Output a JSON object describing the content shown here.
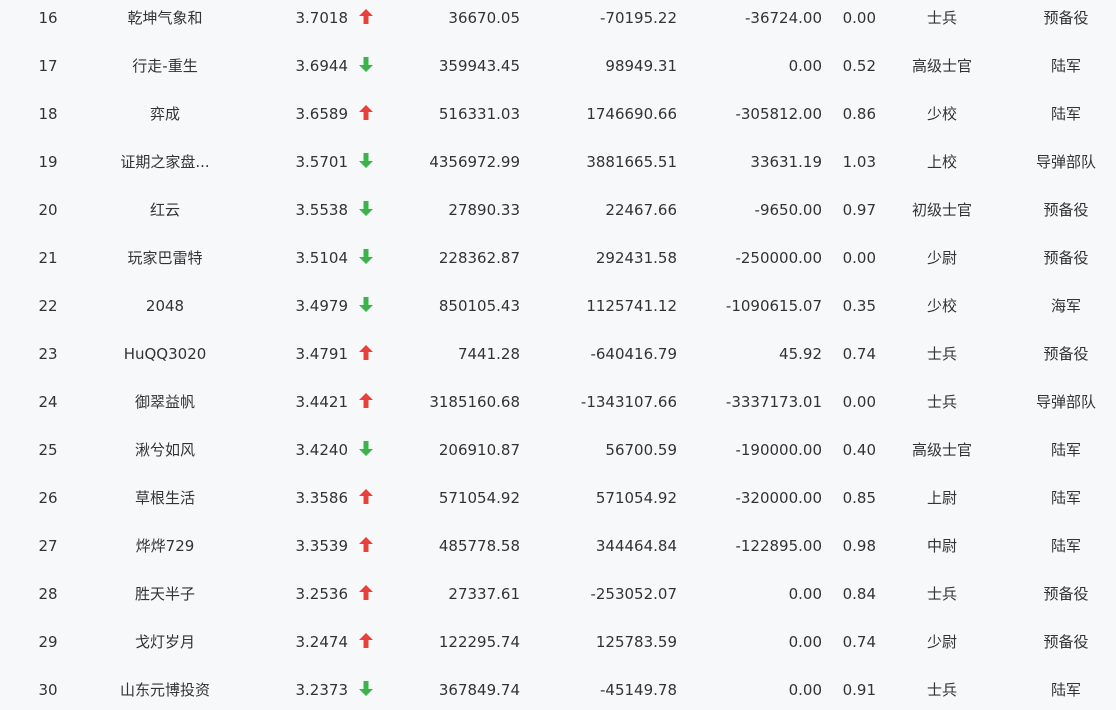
{
  "colors": {
    "up": "#e8413a",
    "down": "#3bb34a",
    "background": "#f7f8fa",
    "text": "#333333"
  },
  "rows": [
    {
      "rank": "16",
      "name": "乾坤气象和",
      "score": "3.7018",
      "trend": "up",
      "v1": "36670.05",
      "v2": "-70195.22",
      "v3": "-36724.00",
      "v4": "0.00",
      "level": "士兵",
      "branch": "预备役"
    },
    {
      "rank": "17",
      "name": "行走-重生",
      "score": "3.6944",
      "trend": "down",
      "v1": "359943.45",
      "v2": "98949.31",
      "v3": "0.00",
      "v4": "0.52",
      "level": "高级士官",
      "branch": "陆军"
    },
    {
      "rank": "18",
      "name": "弈成",
      "score": "3.6589",
      "trend": "up",
      "v1": "516331.03",
      "v2": "1746690.66",
      "v3": "-305812.00",
      "v4": "0.86",
      "level": "少校",
      "branch": "陆军"
    },
    {
      "rank": "19",
      "name": "证期之家盘...",
      "score": "3.5701",
      "trend": "down",
      "v1": "4356972.99",
      "v2": "3881665.51",
      "v3": "33631.19",
      "v4": "1.03",
      "level": "上校",
      "branch": "导弹部队"
    },
    {
      "rank": "20",
      "name": "红云",
      "score": "3.5538",
      "trend": "down",
      "v1": "27890.33",
      "v2": "22467.66",
      "v3": "-9650.00",
      "v4": "0.97",
      "level": "初级士官",
      "branch": "预备役"
    },
    {
      "rank": "21",
      "name": "玩家巴雷特",
      "score": "3.5104",
      "trend": "down",
      "v1": "228362.87",
      "v2": "292431.58",
      "v3": "-250000.00",
      "v4": "0.00",
      "level": "少尉",
      "branch": "预备役"
    },
    {
      "rank": "22",
      "name": "2048",
      "score": "3.4979",
      "trend": "down",
      "v1": "850105.43",
      "v2": "1125741.12",
      "v3": "-1090615.07",
      "v4": "0.35",
      "level": "少校",
      "branch": "海军"
    },
    {
      "rank": "23",
      "name": "HuQQ3020",
      "score": "3.4791",
      "trend": "up",
      "v1": "7441.28",
      "v2": "-640416.79",
      "v3": "45.92",
      "v4": "0.74",
      "level": "士兵",
      "branch": "预备役"
    },
    {
      "rank": "24",
      "name": "御翠益帆",
      "score": "3.4421",
      "trend": "up",
      "v1": "3185160.68",
      "v2": "-1343107.66",
      "v3": "-3337173.01",
      "v4": "0.00",
      "level": "士兵",
      "branch": "导弹部队"
    },
    {
      "rank": "25",
      "name": "湫兮如风",
      "score": "3.4240",
      "trend": "down",
      "v1": "206910.87",
      "v2": "56700.59",
      "v3": "-190000.00",
      "v4": "0.40",
      "level": "高级士官",
      "branch": "陆军"
    },
    {
      "rank": "26",
      "name": "草根生活",
      "score": "3.3586",
      "trend": "up",
      "v1": "571054.92",
      "v2": "571054.92",
      "v3": "-320000.00",
      "v4": "0.85",
      "level": "上尉",
      "branch": "陆军"
    },
    {
      "rank": "27",
      "name": "烨烨729",
      "score": "3.3539",
      "trend": "up",
      "v1": "485778.58",
      "v2": "344464.84",
      "v3": "-122895.00",
      "v4": "0.98",
      "level": "中尉",
      "branch": "陆军"
    },
    {
      "rank": "28",
      "name": "胜天半子",
      "score": "3.2536",
      "trend": "up",
      "v1": "27337.61",
      "v2": "-253052.07",
      "v3": "0.00",
      "v4": "0.84",
      "level": "士兵",
      "branch": "预备役"
    },
    {
      "rank": "29",
      "name": "戈灯岁月",
      "score": "3.2474",
      "trend": "up",
      "v1": "122295.74",
      "v2": "125783.59",
      "v3": "0.00",
      "v4": "0.74",
      "level": "少尉",
      "branch": "预备役"
    },
    {
      "rank": "30",
      "name": "山东元博投资",
      "score": "3.2373",
      "trend": "down",
      "v1": "367849.74",
      "v2": "-45149.78",
      "v3": "0.00",
      "v4": "0.91",
      "level": "士兵",
      "branch": "陆军"
    }
  ]
}
